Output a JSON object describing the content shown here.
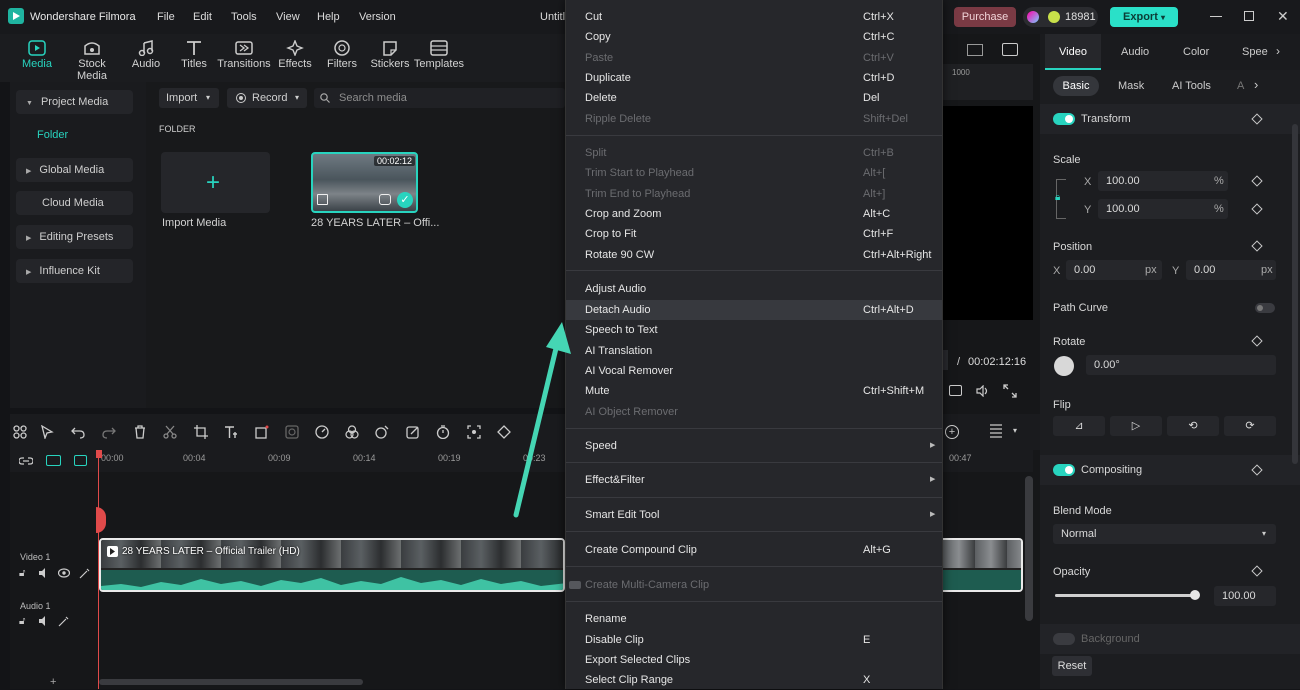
{
  "app": {
    "name": "Wondershare Filmora",
    "title": "Untitl"
  },
  "menubar": [
    "File",
    "Edit",
    "Tools",
    "View",
    "Help",
    "Version"
  ],
  "header": {
    "purchase": "Purchase",
    "points": "18981",
    "export": "Export"
  },
  "toolbar": [
    "Media",
    "Stock Media",
    "Audio",
    "Titles",
    "Transitions",
    "Effects",
    "Filters",
    "Stickers",
    "Templates"
  ],
  "sidebar": {
    "project_media": "Project Media",
    "folder": "Folder",
    "global_media": "Global Media",
    "cloud_media": "Cloud Media",
    "editing_presets": "Editing Presets",
    "influence_kit": "Influence Kit"
  },
  "media": {
    "import": "Import",
    "record": "Record",
    "search_placeholder": "Search media",
    "folder_label": "FOLDER",
    "import_media": "Import Media",
    "clip_name": "28 YEARS LATER – Offi...",
    "clip_duration": "00:02:12"
  },
  "ruler": [
    "00:00",
    "00:04",
    "00:09",
    "00:14",
    "00:19",
    "00:23",
    "00:47"
  ],
  "preview": {
    "ruler_start": "1000",
    "time_sep": "/",
    "total_time": "00:02:12:16"
  },
  "tracks": {
    "video1": "Video 1",
    "audio1": "Audio 1",
    "clip_title": "28 YEARS LATER – Official Trailer (HD)"
  },
  "right_panel": {
    "tabs": [
      "Video",
      "Audio",
      "Color",
      "Spee"
    ],
    "subtabs": [
      "Basic",
      "Mask",
      "AI Tools",
      "A"
    ],
    "transform": "Transform",
    "scale": "Scale",
    "x_label": "X",
    "y_label": "Y",
    "scale_x": "100.00",
    "scale_y": "100.00",
    "pct": "%",
    "position": "Position",
    "pos_x": "0.00",
    "pos_y": "0.00",
    "px": "px",
    "path_curve": "Path Curve",
    "rotate": "Rotate",
    "rotate_val": "0.00°",
    "flip": "Flip",
    "compositing": "Compositing",
    "blend_mode": "Blend Mode",
    "blend_value": "Normal",
    "opacity": "Opacity",
    "opacity_val": "100.00",
    "opacity_level": 1.0,
    "background": "Background",
    "reset": "Reset"
  },
  "context_menu": [
    {
      "label": "Cut",
      "shortcut": "Ctrl+X",
      "disabled": false
    },
    {
      "label": "Copy",
      "shortcut": "Ctrl+C",
      "disabled": false
    },
    {
      "label": "Paste",
      "shortcut": "Ctrl+V",
      "disabled": true
    },
    {
      "label": "Duplicate",
      "shortcut": "Ctrl+D",
      "disabled": false
    },
    {
      "label": "Delete",
      "shortcut": "Del",
      "disabled": false
    },
    {
      "label": "Ripple Delete",
      "shortcut": "Shift+Del",
      "disabled": true
    },
    {
      "sep": true
    },
    {
      "label": "Split",
      "shortcut": "Ctrl+B",
      "disabled": true
    },
    {
      "label": "Trim Start to Playhead",
      "shortcut": "Alt+[",
      "disabled": true
    },
    {
      "label": "Trim End to Playhead",
      "shortcut": "Alt+]",
      "disabled": true
    },
    {
      "label": "Crop and Zoom",
      "shortcut": "Alt+C",
      "disabled": false
    },
    {
      "label": "Crop to Fit",
      "shortcut": "Ctrl+F",
      "disabled": false
    },
    {
      "label": "Rotate 90 CW",
      "shortcut": "Ctrl+Alt+Right",
      "disabled": false
    },
    {
      "sep": true
    },
    {
      "label": "Adjust Audio",
      "shortcut": "",
      "disabled": false
    },
    {
      "label": "Detach Audio",
      "shortcut": "Ctrl+Alt+D",
      "disabled": false,
      "highlight": true
    },
    {
      "label": "Speech to Text",
      "shortcut": "",
      "disabled": false
    },
    {
      "label": "AI Translation",
      "shortcut": "",
      "disabled": false
    },
    {
      "label": "AI Vocal Remover",
      "shortcut": "",
      "disabled": false
    },
    {
      "label": "Mute",
      "shortcut": "Ctrl+Shift+M",
      "disabled": false
    },
    {
      "label": "AI Object Remover",
      "shortcut": "",
      "disabled": true
    },
    {
      "sep": true
    },
    {
      "label": "Speed",
      "shortcut": "",
      "disabled": false,
      "submenu": true
    },
    {
      "sep": true
    },
    {
      "label": "Effect&Filter",
      "shortcut": "",
      "disabled": false,
      "submenu": true
    },
    {
      "sep": true
    },
    {
      "label": "Smart Edit Tool",
      "shortcut": "",
      "disabled": false,
      "submenu": true
    },
    {
      "sep": true
    },
    {
      "label": "Create Compound Clip",
      "shortcut": "Alt+G",
      "disabled": false
    },
    {
      "sep": true
    },
    {
      "label": "Create Multi-Camera Clip",
      "shortcut": "",
      "disabled": true
    },
    {
      "sep": true
    },
    {
      "label": "Rename",
      "shortcut": "",
      "disabled": false
    },
    {
      "label": "Disable Clip",
      "shortcut": "E",
      "disabled": false
    },
    {
      "label": "Export Selected Clips",
      "shortcut": "",
      "disabled": false
    },
    {
      "label": "Select Clip Range",
      "shortcut": "X",
      "disabled": false
    }
  ],
  "colors": {
    "accent": "#28d4bf",
    "purchase": "#7a3a44",
    "export": "#2ae0c8",
    "arrow": "#45d6b4"
  }
}
